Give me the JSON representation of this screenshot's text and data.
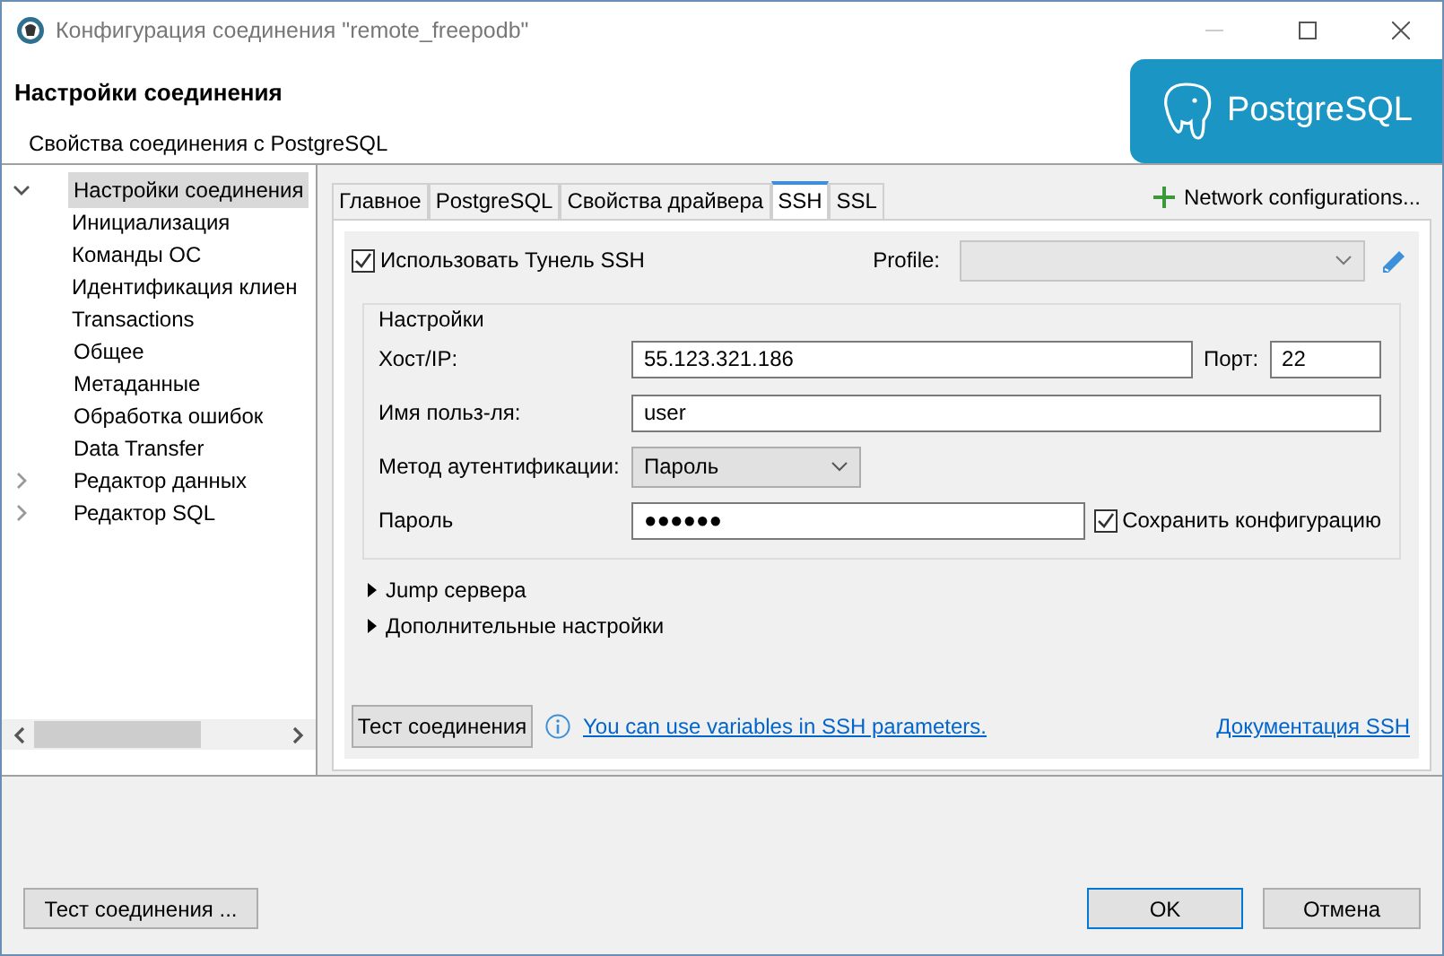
{
  "window": {
    "title": "Конфигурация соединения \"remote_freepodb\""
  },
  "header": {
    "title": "Настройки соединения",
    "subtitle": "Свойства соединения с PostgreSQL",
    "logo_text": "PostgreSQL"
  },
  "nav_tree": [
    {
      "label": "Настройки соединения",
      "expanded": true,
      "selected": true,
      "children": [
        {
          "label": "Инициализация",
          "selected": false
        },
        {
          "label": "Команды ОС",
          "selected": false
        },
        {
          "label": "Идентификация клиен",
          "selected": false
        },
        {
          "label": "Transactions",
          "selected": false
        }
      ]
    },
    {
      "label": "Общее",
      "selected": false
    },
    {
      "label": "Метаданные",
      "selected": false
    },
    {
      "label": "Обработка ошибок",
      "selected": false
    },
    {
      "label": "Data Transfer",
      "selected": false
    },
    {
      "label": "Редактор данных",
      "expanded": false,
      "selected": false
    },
    {
      "label": "Редактор SQL",
      "expanded": false,
      "selected": false
    }
  ],
  "tabs": [
    {
      "label": "Главное",
      "selected": false
    },
    {
      "label": "PostgreSQL",
      "selected": false
    },
    {
      "label": "Свойства драйвера",
      "selected": false
    },
    {
      "label": "SSH",
      "selected": true
    },
    {
      "label": "SSL",
      "selected": false
    }
  ],
  "network_button": "Network configurations...",
  "ssh": {
    "use_tunnel": {
      "label": "Использовать Тунель SSH",
      "checked": true
    },
    "profile_label": "Profile:",
    "group_title": "Настройки",
    "host": {
      "label": "Хост/IP:",
      "value": "55.123.321.186",
      "port_label": "Порт:",
      "port_value": "22"
    },
    "user": {
      "label": "Имя польз-ля:",
      "value": "user"
    },
    "auth": {
      "label": "Метод аутентификации:",
      "value": "Пароль"
    },
    "password": {
      "label": "Пароль",
      "value": "●●●●●●",
      "save_label": "Сохранить конфигурацию",
      "save_checked": true
    },
    "sections": [
      {
        "label": "Jump сервера",
        "expanded": false
      },
      {
        "label": "Дополнительные настройки",
        "expanded": false
      }
    ],
    "test_button": "Тест соединения",
    "info_link": "You can use variables in SSH parameters.",
    "docs_link": "Документация SSH"
  },
  "footer": {
    "test_button": "Тест соединения ...",
    "ok_button": "OK",
    "cancel_button": "Отмена"
  }
}
